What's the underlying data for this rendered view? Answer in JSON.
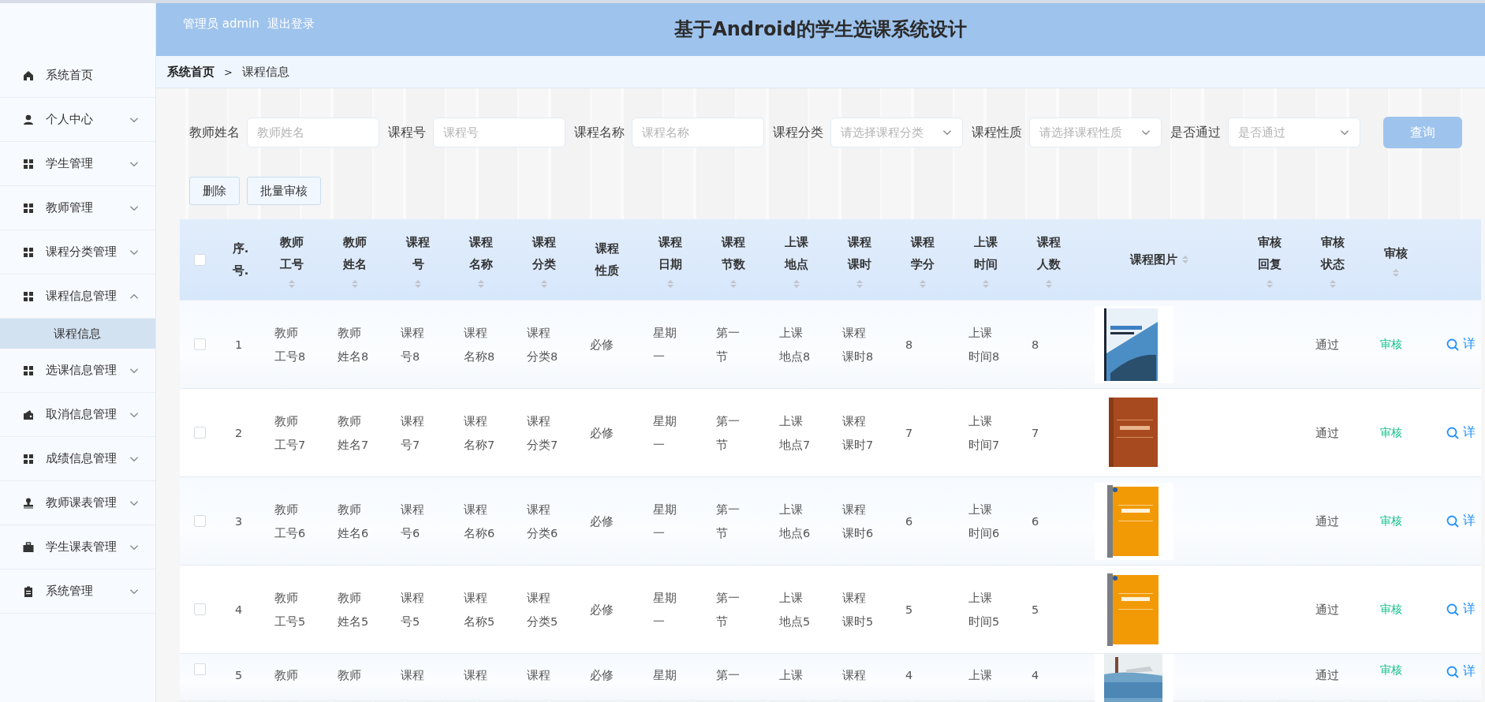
{
  "header": {
    "user": "管理员 admin",
    "logout": "退出登录",
    "title": "基于Android的学生选课系统设计"
  },
  "sidebar": {
    "items": [
      {
        "label": "系统首页"
      },
      {
        "label": "个人中心",
        "expanded": false
      },
      {
        "label": "学生管理",
        "expanded": false
      },
      {
        "label": "教师管理",
        "expanded": false
      },
      {
        "label": "课程分类管理",
        "expanded": false
      },
      {
        "label": "课程信息管理",
        "expanded": true,
        "children": [
          {
            "label": "课程信息",
            "selected": true
          }
        ]
      },
      {
        "label": "选课信息管理",
        "expanded": false
      },
      {
        "label": "取消信息管理",
        "expanded": false
      },
      {
        "label": "成绩信息管理",
        "expanded": false
      },
      {
        "label": "教师课表管理",
        "expanded": false
      },
      {
        "label": "学生课表管理",
        "expanded": false
      },
      {
        "label": "系统管理",
        "expanded": false
      }
    ]
  },
  "breadcrumb": {
    "items": [
      "系统首页",
      "课程信息"
    ],
    "separator": ">"
  },
  "filters": [
    {
      "kind": "input",
      "label": "教师姓名",
      "placeholder": "教师姓名"
    },
    {
      "kind": "input",
      "label": "课程号",
      "placeholder": "课程号"
    },
    {
      "kind": "input",
      "label": "课程名称",
      "placeholder": "课程名称"
    },
    {
      "kind": "select",
      "label": "课程分类",
      "placeholder": "请选择课程分类"
    },
    {
      "kind": "select",
      "label": "课程性质",
      "placeholder": "请选择课程性质"
    },
    {
      "kind": "select",
      "label": "是否通过",
      "placeholder": "是否通过"
    }
  ],
  "search_button": "查询",
  "actions": [
    "删除",
    "批量审核"
  ],
  "table": {
    "header_checked": false,
    "columns": [
      {
        "kind": "text",
        "label": "序.号.",
        "sortable": false
      },
      {
        "kind": "text",
        "label": "教师工号",
        "sortable": true
      },
      {
        "kind": "text",
        "label": "教师姓名",
        "sortable": true
      },
      {
        "kind": "text",
        "label": "课程号",
        "sortable": true
      },
      {
        "kind": "text",
        "label": "课程名称",
        "sortable": true
      },
      {
        "kind": "text",
        "label": "课程分类",
        "sortable": true
      },
      {
        "kind": "text",
        "label": "课程性质",
        "sortable": false
      },
      {
        "kind": "text",
        "label": "课程日期",
        "sortable": true
      },
      {
        "kind": "text",
        "label": "课程节数",
        "sortable": true
      },
      {
        "kind": "text",
        "label": "上课地点",
        "sortable": true
      },
      {
        "kind": "text",
        "label": "课程课时",
        "sortable": true
      },
      {
        "kind": "text",
        "label": "课程学分",
        "sortable": true
      },
      {
        "kind": "text",
        "label": "上课时间",
        "sortable": true
      },
      {
        "kind": "text",
        "label": "课程人数",
        "sortable": true
      },
      {
        "label": "课程图片",
        "sortable": true
      },
      {
        "kind": "text",
        "label": "审核回复",
        "sortable": true
      },
      {
        "kind": "text",
        "label": "审核状态",
        "sortable": true
      },
      {
        "kind": "text",
        "label": "审核",
        "sortable": true
      }
    ],
    "rows": [
      {
        "checked": false,
        "cells": [
          "1",
          "教师工号8",
          "教师姓名8",
          "课程号8",
          "课程名称8",
          "课程分类8",
          "必修",
          "星期一",
          "第一节",
          "上课地点8",
          "课程课时8",
          "8",
          "上课时间8",
          "8"
        ],
        "status": "通过",
        "review": "审核",
        "detail": "详"
      },
      {
        "checked": false,
        "cells": [
          "2",
          "教师工号7",
          "教师姓名7",
          "课程号7",
          "课程名称7",
          "课程分类7",
          "必修",
          "星期一",
          "第一节",
          "上课地点7",
          "课程课时7",
          "7",
          "上课时间7",
          "7"
        ],
        "status": "通过",
        "review": "审核",
        "detail": "详"
      },
      {
        "checked": false,
        "cells": [
          "3",
          "教师工号6",
          "教师姓名6",
          "课程号6",
          "课程名称6",
          "课程分类6",
          "必修",
          "星期一",
          "第一节",
          "上课地点6",
          "课程课时6",
          "6",
          "上课时间6",
          "6"
        ],
        "status": "通过",
        "review": "审核",
        "detail": "详"
      },
      {
        "checked": false,
        "cells": [
          "4",
          "教师工号5",
          "教师姓名5",
          "课程号5",
          "课程名称5",
          "课程分类5",
          "必修",
          "星期一",
          "第一节",
          "上课地点5",
          "课程课时5",
          "5",
          "上课时间5",
          "5"
        ],
        "status": "通过",
        "review": "审核",
        "detail": "详"
      },
      {
        "checked": false,
        "cells": [
          "5",
          "教师",
          "教师",
          "课程",
          "课程",
          "课程",
          "必修",
          "星期",
          "第一",
          "上课",
          "课程",
          "4",
          "上课",
          "4"
        ],
        "status": "通过",
        "review": "审核",
        "detail": "详"
      }
    ]
  }
}
